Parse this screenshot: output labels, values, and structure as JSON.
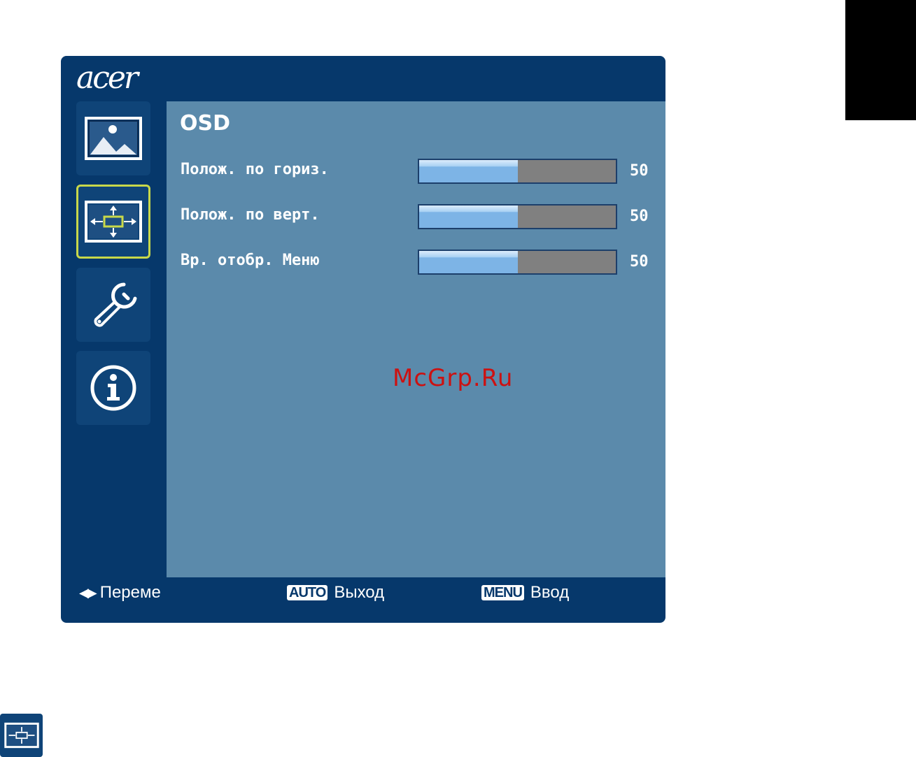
{
  "brand": {
    "logo_text": "acer"
  },
  "nav": {
    "items": [
      {
        "id": "picture",
        "icon": "picture-icon",
        "active": false
      },
      {
        "id": "osd",
        "icon": "osd-position-icon",
        "active": true
      },
      {
        "id": "settings",
        "icon": "wrench-settings-icon",
        "active": false
      },
      {
        "id": "information",
        "icon": "info-icon",
        "active": false
      }
    ]
  },
  "panel": {
    "title": "OSD",
    "settings": [
      {
        "label": "Полож. по гориз.",
        "value": "50",
        "level_percent": 50
      },
      {
        "label": "Полож. по верт.",
        "value": "50",
        "level_percent": 50
      },
      {
        "label": "Вр. отобр. Меню",
        "value": "50",
        "level_percent": 50
      }
    ]
  },
  "watermark": "McGrp.Ru",
  "footer": {
    "move_arrows": "◀▶",
    "move_label": "Переме",
    "auto_key": "AUTO",
    "auto_label": "Выход",
    "menu_key": "MENU",
    "menu_label": "Ввод"
  },
  "colors": {
    "frame": "#06386b",
    "content_bg": "#5b8aab",
    "tile_bg": "#0f4478",
    "active_outline": "#c8d84a",
    "slider_fill": "#7db4e6",
    "slider_track": "#808080",
    "watermark": "#cc1111"
  }
}
